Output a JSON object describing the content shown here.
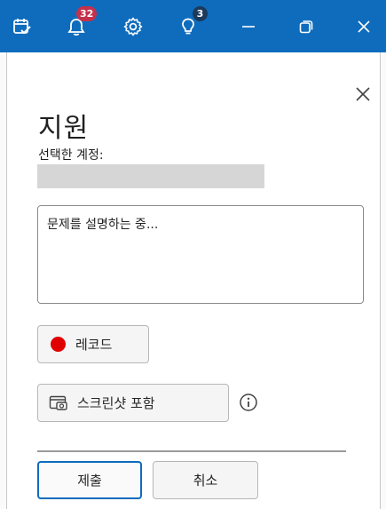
{
  "titlebar": {
    "notifications_count": "32",
    "tips_count": "3"
  },
  "panel": {
    "title": "지원",
    "selected_account_label": "선택한 계정:",
    "description_placeholder": "문제를 설명하는 중...",
    "record_label": "레코드",
    "include_screenshot_label": "스크린샷 포함",
    "submit_label": "제출",
    "cancel_label": "취소"
  },
  "colors": {
    "titlebar": "#0f6cbd",
    "record_dot": "#e00000",
    "notification_badge": "#c4314b",
    "tips_badge": "#1b3a5c"
  }
}
